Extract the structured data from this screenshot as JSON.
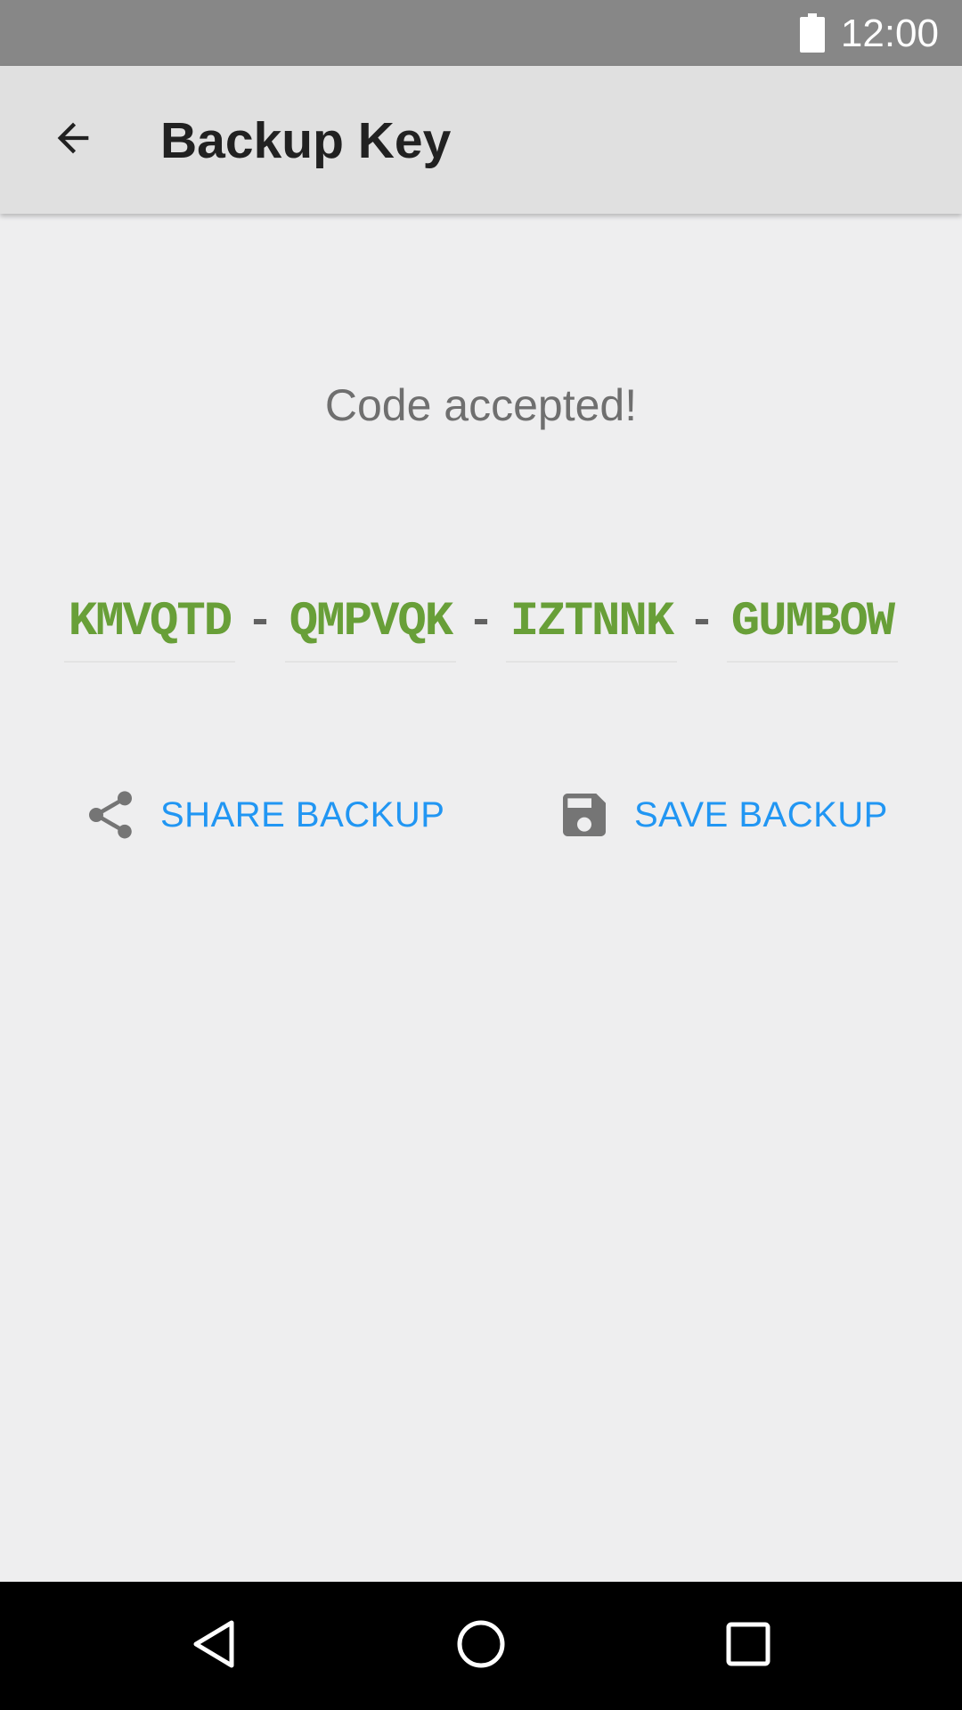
{
  "status_bar": {
    "time": "12:00",
    "battery_icon": "battery-full-icon"
  },
  "app_bar": {
    "title": "Backup Key",
    "back_icon": "arrow-back-icon"
  },
  "content": {
    "message": "Code accepted!",
    "code_parts": [
      "KMVQTD",
      "QMPVQK",
      "IZTNNK",
      "GUMBOW"
    ],
    "separator": "-",
    "share_button": {
      "label": "SHARE BACKUP",
      "icon": "share-icon"
    },
    "save_button": {
      "label": "SAVE BACKUP",
      "icon": "floppy-disk-icon"
    }
  },
  "nav_bar": {
    "back": "nav-back-icon",
    "home": "nav-home-icon",
    "recents": "nav-recents-icon"
  },
  "colors": {
    "status_bar": "#878787",
    "app_bar": "#e0e0e0",
    "background": "#eeeeef",
    "code_text": "#689f38",
    "accent": "#2196f3",
    "message_text": "#6f6f6f"
  }
}
